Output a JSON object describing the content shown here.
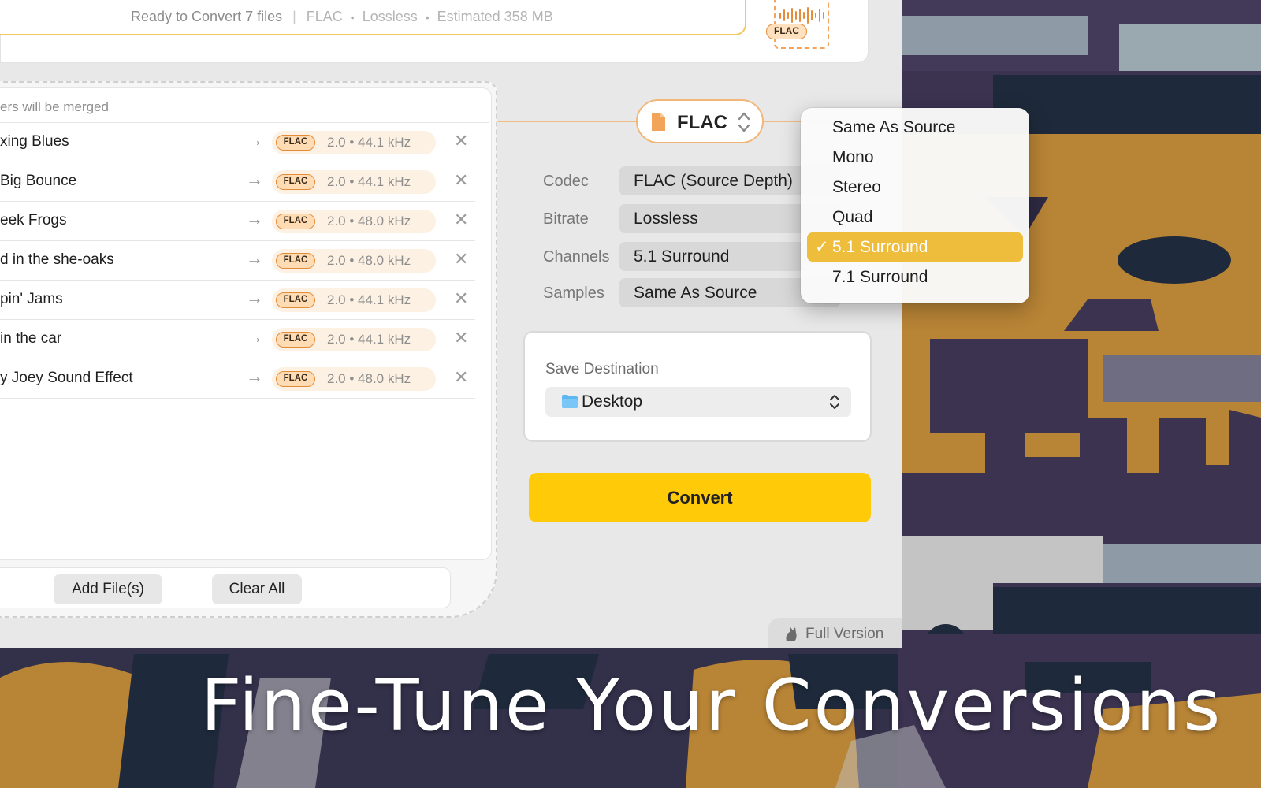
{
  "status": {
    "ready_text": "Ready to Convert 7 files",
    "separator": "|",
    "format": "FLAC",
    "quality": "Lossless",
    "estimate": "Estimated 358 MB",
    "dot": "•"
  },
  "format_icon_badge": "FLAC",
  "file_list": {
    "merge_note": "ers will be merged",
    "arrow": "→",
    "remove": "✕",
    "files": [
      {
        "name": "xing Blues",
        "badge": "FLAC",
        "spec": "2.0 • 44.1 kHz"
      },
      {
        "name": "Big Bounce",
        "badge": "FLAC",
        "spec": "2.0 • 44.1 kHz"
      },
      {
        "name": "eek Frogs",
        "badge": "FLAC",
        "spec": "2.0 • 48.0 kHz"
      },
      {
        "name": "d in the she-oaks",
        "badge": "FLAC",
        "spec": "2.0 • 48.0 kHz"
      },
      {
        "name": "pin' Jams",
        "badge": "FLAC",
        "spec": "2.0 • 44.1 kHz"
      },
      {
        "name": "in the car",
        "badge": "FLAC",
        "spec": "2.0 • 44.1 kHz"
      },
      {
        "name": "y Joey Sound Effect",
        "badge": "FLAC",
        "spec": "2.0 • 48.0 kHz"
      }
    ],
    "add_button": "Add File(s)",
    "clear_button": "Clear All"
  },
  "format_selector": {
    "label": "FLAC"
  },
  "settings": {
    "codec_label": "Codec",
    "codec_value": "FLAC (Source Depth)",
    "bitrate_label": "Bitrate",
    "bitrate_value": "Lossless",
    "channels_label": "Channels",
    "channels_value": "5.1 Surround",
    "samples_label": "Samples",
    "samples_value": "Same As Source"
  },
  "channels_menu": {
    "items": [
      "Same As Source",
      "Mono",
      "Stereo",
      "Quad",
      "5.1 Surround",
      "7.1 Surround"
    ],
    "selected": "5.1 Surround",
    "check": "✓"
  },
  "destination": {
    "title": "Save Destination",
    "value": "Desktop"
  },
  "convert_button": "Convert",
  "full_version": "Full Version",
  "caption": "Fine-Tune Your Conversions",
  "colors": {
    "accent_yellow": "#ffca08",
    "menu_selection": "#efbd3c",
    "flac_orange": "#e48b38"
  }
}
